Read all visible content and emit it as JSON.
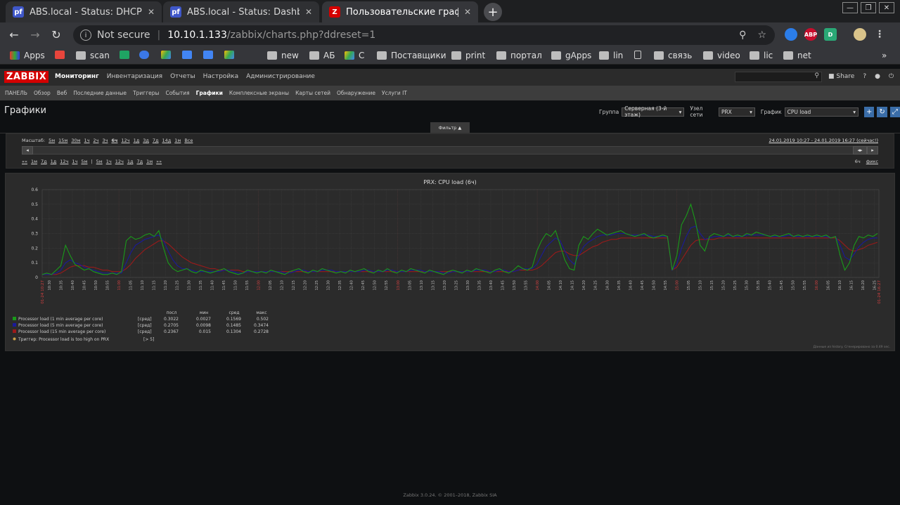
{
  "browser": {
    "tabs": [
      {
        "title": "ABS.local - Status: DHCP Lease",
        "favicon_color": "#3f57c9",
        "favicon_text": "pf"
      },
      {
        "title": "ABS.local - Status: Dashboard",
        "favicon_color": "#3f57c9",
        "favicon_text": "pf"
      },
      {
        "title": "Пользовательские графики [",
        "favicon_color": "#d40000",
        "favicon_text": "Z"
      }
    ],
    "omnibox": {
      "security": "Not secure",
      "host": "10.10.1.133",
      "path": "/zabbix/charts.php?ddreset=1"
    },
    "extensions": [
      {
        "name": "vpn-extension-icon",
        "text": "",
        "color": "#2b7de9"
      },
      {
        "name": "adblock-icon",
        "text": "ABP",
        "color": "#c70d2c"
      },
      {
        "name": "d-extension-icon",
        "text": "D",
        "color": "#2aa876"
      },
      {
        "name": "profile-avatar-icon",
        "text": "",
        "color": "#d9c38a"
      }
    ],
    "bookmarks": [
      "Apps",
      "",
      "scan",
      "",
      "",
      "",
      "",
      "",
      "",
      "new",
      "АБ",
      "С",
      "Поставщики",
      "print",
      "портал",
      "gApps",
      "lin",
      "",
      "связь",
      "video",
      "lic",
      "net"
    ]
  },
  "zabbix": {
    "logo": "ZABBIX",
    "main_menu": [
      "Мониторинг",
      "Инвентаризация",
      "Отчеты",
      "Настройка",
      "Администрирование"
    ],
    "share": "Share",
    "sub_menu": [
      "ПАНЕЛЬ",
      "Обзор",
      "Веб",
      "Последние данные",
      "Триггеры",
      "События",
      "Графики",
      "Комплексные экраны",
      "Карты сетей",
      "Обнаружение",
      "Услуги IT"
    ],
    "page_title": "Графики",
    "group_label": "Группа",
    "group_value": "Серверная (3-й этаж)",
    "host_label": "Узел сети",
    "host_value": "PRX",
    "graph_label": "График",
    "graph_value": "CPU load",
    "filter_label": "Фильтр ▲",
    "zoom_label": "Масштаб:",
    "zoom_items": [
      "5м",
      "15м",
      "30м",
      "1ч",
      "2ч",
      "3ч",
      "6ч",
      "12ч",
      "1д",
      "3д",
      "7д",
      "14д",
      "1м",
      "Все"
    ],
    "time_range": "24.01.2019 10:27 - 24.01.2019 16:27 (сейчас!)",
    "nav_items": [
      "««",
      "1м",
      "7д",
      "1д",
      "12ч",
      "1ч",
      "5м",
      "|",
      "5м",
      "1ч",
      "12ч",
      "1д",
      "7д",
      "1м",
      "»»"
    ],
    "period": "6ч",
    "fixed": "фикс",
    "footer": "Zabbix 3.0.24. © 2001–2018, Zabbix SIA"
  },
  "chart_data": {
    "type": "line",
    "title": "PRX: CPU load (6ч)",
    "ylim": [
      0,
      0.6
    ],
    "yticks": [
      "0.6",
      "0.5",
      "0.4",
      "0.3",
      "0.2",
      "0.1",
      "0"
    ],
    "x_start_label": "01-24 10:27",
    "x_end_label": "01-24 16:27",
    "grid": true,
    "x_tick_labels": [
      "10:30",
      "10:35",
      "10:40",
      "10:45",
      "10:50",
      "10:55",
      "11:00",
      "11:05",
      "11:10",
      "11:15",
      "11:20",
      "11:25",
      "11:30",
      "11:35",
      "11:40",
      "11:45",
      "11:50",
      "11:55",
      "12:00",
      "12:05",
      "12:10",
      "12:15",
      "12:20",
      "12:25",
      "12:30",
      "12:35",
      "12:40",
      "12:45",
      "12:50",
      "12:55",
      "13:00",
      "13:05",
      "13:10",
      "13:15",
      "13:20",
      "13:25",
      "13:30",
      "13:35",
      "13:40",
      "13:45",
      "13:50",
      "13:55",
      "14:00",
      "14:05",
      "14:10",
      "14:15",
      "14:20",
      "14:25",
      "14:30",
      "14:35",
      "14:40",
      "14:45",
      "14:50",
      "14:55",
      "15:00",
      "15:05",
      "15:10",
      "15:15",
      "15:20",
      "15:25",
      "15:30",
      "15:35",
      "15:40",
      "15:45",
      "15:50",
      "15:55",
      "16:00",
      "16:05",
      "16:10",
      "16:15",
      "16:20",
      "16:25"
    ],
    "x_hour_labels": [
      "11:00",
      "12:00",
      "13:00",
      "14:00",
      "15:00",
      "16:00"
    ],
    "x_minutes": [
      3,
      8,
      13,
      18,
      23,
      28,
      33,
      38,
      43,
      48,
      53,
      58,
      63,
      68,
      73,
      78,
      83,
      88,
      93,
      98,
      103,
      108,
      113,
      118,
      123,
      128,
      133,
      138,
      143,
      148,
      153,
      158,
      163,
      168,
      173,
      178,
      183,
      188,
      193,
      198,
      203,
      208,
      213,
      218,
      223,
      228,
      233,
      238,
      243,
      248,
      253,
      258,
      263,
      268,
      273,
      278,
      283,
      288,
      293,
      298,
      303,
      308,
      313,
      318,
      323,
      328,
      333,
      338,
      343,
      348,
      353,
      358
    ],
    "legend_header": [
      "посл",
      "мин",
      "сред",
      "макс"
    ],
    "series": [
      {
        "name": "Processor load (1 min average per core)",
        "agg": "[сред]",
        "color": "#1a9a1a",
        "last": "0.3022",
        "min": "0.0027",
        "avg": "0.1569",
        "max": "0.502",
        "values": [
          0.02,
          0.03,
          0.02,
          0.05,
          0.08,
          0.22,
          0.15,
          0.09,
          0.07,
          0.05,
          0.06,
          0.04,
          0.03,
          0.02,
          0.02,
          0.03,
          0.02,
          0.04,
          0.25,
          0.28,
          0.26,
          0.27,
          0.29,
          0.3,
          0.28,
          0.32,
          0.2,
          0.1,
          0.06,
          0.04,
          0.05,
          0.06,
          0.04,
          0.03,
          0.05,
          0.04,
          0.03,
          0.04,
          0.05,
          0.06,
          0.04,
          0.03,
          0.02,
          0.03,
          0.05,
          0.04,
          0.03,
          0.04,
          0.03,
          0.05,
          0.04,
          0.03,
          0.02,
          0.04,
          0.05,
          0.06,
          0.04,
          0.03,
          0.05,
          0.04,
          0.06,
          0.05,
          0.04,
          0.03,
          0.04,
          0.03,
          0.05,
          0.04,
          0.05,
          0.06,
          0.04,
          0.03,
          0.05,
          0.04,
          0.06,
          0.04,
          0.03,
          0.05,
          0.04,
          0.06,
          0.05,
          0.04,
          0.03,
          0.05,
          0.04,
          0.03,
          0.02,
          0.04,
          0.05,
          0.04,
          0.03,
          0.05,
          0.04,
          0.06,
          0.05,
          0.04,
          0.03,
          0.05,
          0.06,
          0.04,
          0.03,
          0.05,
          0.08,
          0.06,
          0.05,
          0.07,
          0.18,
          0.25,
          0.3,
          0.28,
          0.32,
          0.22,
          0.12,
          0.06,
          0.05,
          0.22,
          0.28,
          0.26,
          0.3,
          0.33,
          0.31,
          0.29,
          0.3,
          0.31,
          0.32,
          0.3,
          0.29,
          0.28,
          0.29,
          0.3,
          0.28,
          0.27,
          0.28,
          0.29,
          0.28,
          0.05,
          0.15,
          0.36,
          0.42,
          0.5,
          0.38,
          0.22,
          0.18,
          0.28,
          0.3,
          0.29,
          0.28,
          0.3,
          0.28,
          0.29,
          0.28,
          0.3,
          0.29,
          0.31,
          0.3,
          0.29,
          0.28,
          0.29,
          0.28,
          0.29,
          0.3,
          0.28,
          0.29,
          0.28,
          0.29,
          0.28,
          0.29,
          0.28,
          0.29,
          0.27,
          0.28,
          0.15,
          0.05,
          0.1,
          0.22,
          0.28,
          0.27,
          0.29,
          0.28,
          0.3
        ]
      },
      {
        "name": "Processor load (5 min average per core)",
        "agg": "[сред]",
        "color": "#1a1a9a",
        "last": "0.2705",
        "min": "0.0098",
        "avg": "0.1485",
        "max": "0.3474",
        "values": [
          0.02,
          0.02,
          0.02,
          0.03,
          0.05,
          0.1,
          0.12,
          0.1,
          0.09,
          0.07,
          0.06,
          0.05,
          0.04,
          0.03,
          0.03,
          0.03,
          0.03,
          0.03,
          0.1,
          0.17,
          0.22,
          0.24,
          0.26,
          0.27,
          0.28,
          0.29,
          0.25,
          0.18,
          0.12,
          0.08,
          0.06,
          0.06,
          0.05,
          0.04,
          0.04,
          0.04,
          0.04,
          0.04,
          0.04,
          0.05,
          0.05,
          0.04,
          0.03,
          0.03,
          0.04,
          0.04,
          0.04,
          0.04,
          0.04,
          0.04,
          0.04,
          0.04,
          0.03,
          0.03,
          0.04,
          0.05,
          0.05,
          0.04,
          0.04,
          0.04,
          0.05,
          0.05,
          0.05,
          0.04,
          0.04,
          0.04,
          0.04,
          0.04,
          0.04,
          0.05,
          0.05,
          0.04,
          0.04,
          0.04,
          0.05,
          0.05,
          0.04,
          0.04,
          0.04,
          0.05,
          0.05,
          0.05,
          0.04,
          0.04,
          0.04,
          0.04,
          0.03,
          0.03,
          0.04,
          0.04,
          0.04,
          0.04,
          0.04,
          0.05,
          0.05,
          0.05,
          0.04,
          0.04,
          0.05,
          0.05,
          0.04,
          0.04,
          0.05,
          0.06,
          0.06,
          0.06,
          0.09,
          0.15,
          0.21,
          0.24,
          0.27,
          0.25,
          0.18,
          0.12,
          0.09,
          0.15,
          0.21,
          0.24,
          0.26,
          0.28,
          0.29,
          0.29,
          0.29,
          0.3,
          0.3,
          0.3,
          0.29,
          0.29,
          0.29,
          0.29,
          0.29,
          0.28,
          0.28,
          0.28,
          0.28,
          0.05,
          0.09,
          0.2,
          0.28,
          0.34,
          0.35,
          0.3,
          0.26,
          0.27,
          0.28,
          0.28,
          0.28,
          0.29,
          0.28,
          0.28,
          0.28,
          0.29,
          0.29,
          0.29,
          0.29,
          0.29,
          0.28,
          0.28,
          0.28,
          0.28,
          0.29,
          0.28,
          0.28,
          0.28,
          0.28,
          0.28,
          0.28,
          0.28,
          0.28,
          0.27,
          0.28,
          0.22,
          0.14,
          0.12,
          0.16,
          0.21,
          0.24,
          0.26,
          0.27,
          0.27
        ]
      },
      {
        "name": "Processor load (15 min average per core)",
        "agg": "[сред]",
        "color": "#9a1a1a",
        "last": "0.2367",
        "min": "0.015",
        "avg": "0.1304",
        "max": "0.2728",
        "values": [
          0.02,
          0.02,
          0.02,
          0.02,
          0.03,
          0.05,
          0.07,
          0.08,
          0.08,
          0.08,
          0.07,
          0.07,
          0.06,
          0.05,
          0.05,
          0.04,
          0.04,
          0.04,
          0.06,
          0.09,
          0.13,
          0.16,
          0.19,
          0.21,
          0.23,
          0.25,
          0.25,
          0.23,
          0.2,
          0.17,
          0.14,
          0.12,
          0.1,
          0.09,
          0.08,
          0.07,
          0.06,
          0.06,
          0.05,
          0.05,
          0.05,
          0.05,
          0.05,
          0.04,
          0.04,
          0.04,
          0.04,
          0.04,
          0.04,
          0.04,
          0.04,
          0.04,
          0.04,
          0.04,
          0.04,
          0.04,
          0.04,
          0.04,
          0.04,
          0.04,
          0.04,
          0.04,
          0.04,
          0.04,
          0.04,
          0.04,
          0.04,
          0.04,
          0.04,
          0.04,
          0.04,
          0.04,
          0.04,
          0.04,
          0.04,
          0.04,
          0.04,
          0.04,
          0.04,
          0.04,
          0.04,
          0.04,
          0.04,
          0.04,
          0.04,
          0.04,
          0.04,
          0.04,
          0.04,
          0.04,
          0.04,
          0.04,
          0.04,
          0.04,
          0.04,
          0.04,
          0.04,
          0.04,
          0.04,
          0.04,
          0.04,
          0.04,
          0.05,
          0.05,
          0.05,
          0.05,
          0.06,
          0.08,
          0.11,
          0.14,
          0.17,
          0.18,
          0.18,
          0.16,
          0.15,
          0.15,
          0.17,
          0.19,
          0.21,
          0.22,
          0.24,
          0.25,
          0.26,
          0.26,
          0.27,
          0.27,
          0.27,
          0.27,
          0.27,
          0.27,
          0.27,
          0.27,
          0.27,
          0.27,
          0.27,
          0.05,
          0.07,
          0.12,
          0.17,
          0.22,
          0.25,
          0.26,
          0.26,
          0.26,
          0.26,
          0.27,
          0.27,
          0.27,
          0.27,
          0.27,
          0.27,
          0.27,
          0.27,
          0.27,
          0.27,
          0.27,
          0.27,
          0.27,
          0.27,
          0.27,
          0.27,
          0.27,
          0.27,
          0.27,
          0.27,
          0.27,
          0.27,
          0.27,
          0.27,
          0.27,
          0.27,
          0.25,
          0.22,
          0.19,
          0.18,
          0.19,
          0.2,
          0.22,
          0.23,
          0.24
        ]
      }
    ],
    "trigger": {
      "label": "Триггер: Processor load is too high on PRX",
      "cond": "[> 5]",
      "color": "#c8a048"
    },
    "data_source": "Данные из history. Сгенерировано за 0.49 sec."
  }
}
